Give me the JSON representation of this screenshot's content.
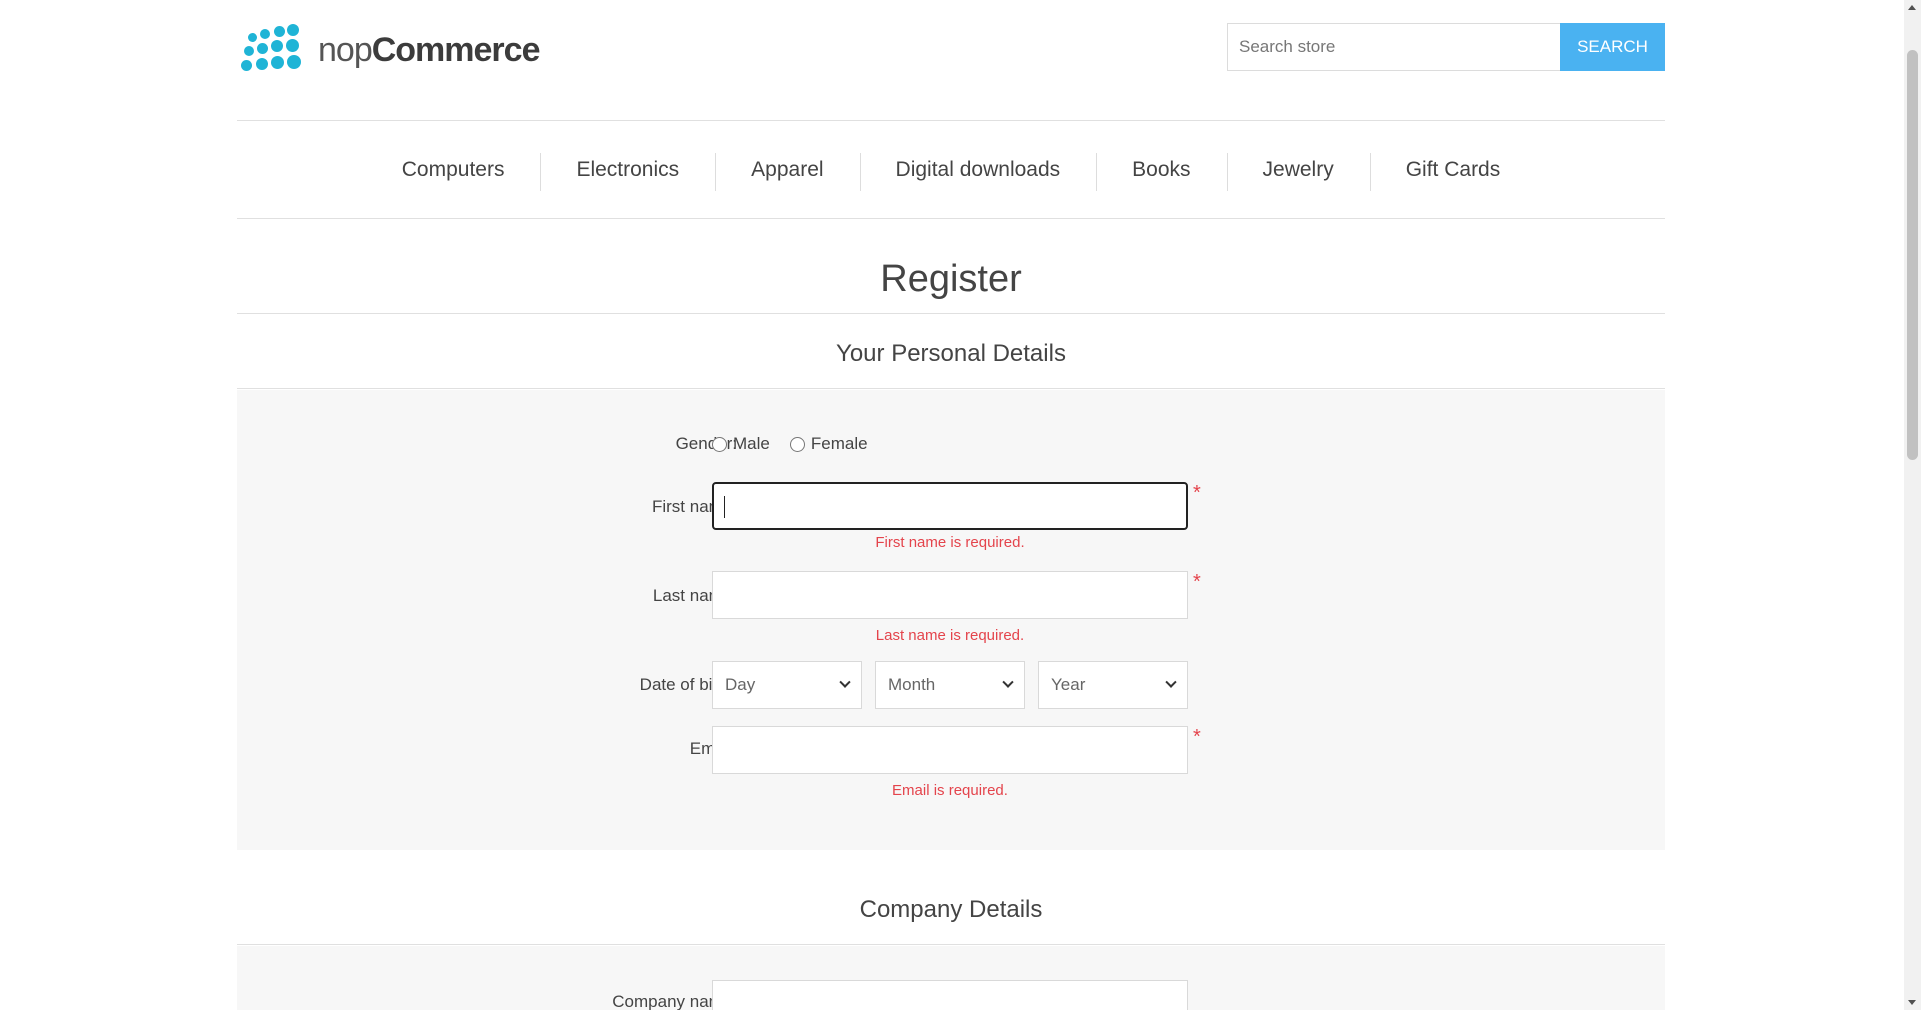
{
  "header": {
    "logo_light": "nop",
    "logo_bold": "Commerce",
    "search_placeholder": "Search store",
    "search_button": "SEARCH"
  },
  "nav": {
    "items": [
      "Computers",
      "Electronics",
      "Apparel",
      "Digital downloads",
      "Books",
      "Jewelry",
      "Gift Cards"
    ]
  },
  "page": {
    "title": "Register"
  },
  "personal": {
    "title": "Your Personal Details",
    "gender_label": "Gender:",
    "male_label": "Male",
    "female_label": "Female",
    "first_name_label": "First name:",
    "first_name_error": "First name is required.",
    "last_name_label": "Last name:",
    "last_name_error": "Last name is required.",
    "dob_label": "Date of birth:",
    "day_value": "Day",
    "month_value": "Month",
    "year_value": "Year",
    "email_label": "Email:",
    "email_error": "Email is required.",
    "required_mark": "*"
  },
  "company": {
    "title": "Company Details",
    "company_name_label": "Company name:"
  },
  "colors": {
    "accent": "#4ab2f1",
    "logo": "#1fb4d6",
    "error": "#e4444c"
  }
}
